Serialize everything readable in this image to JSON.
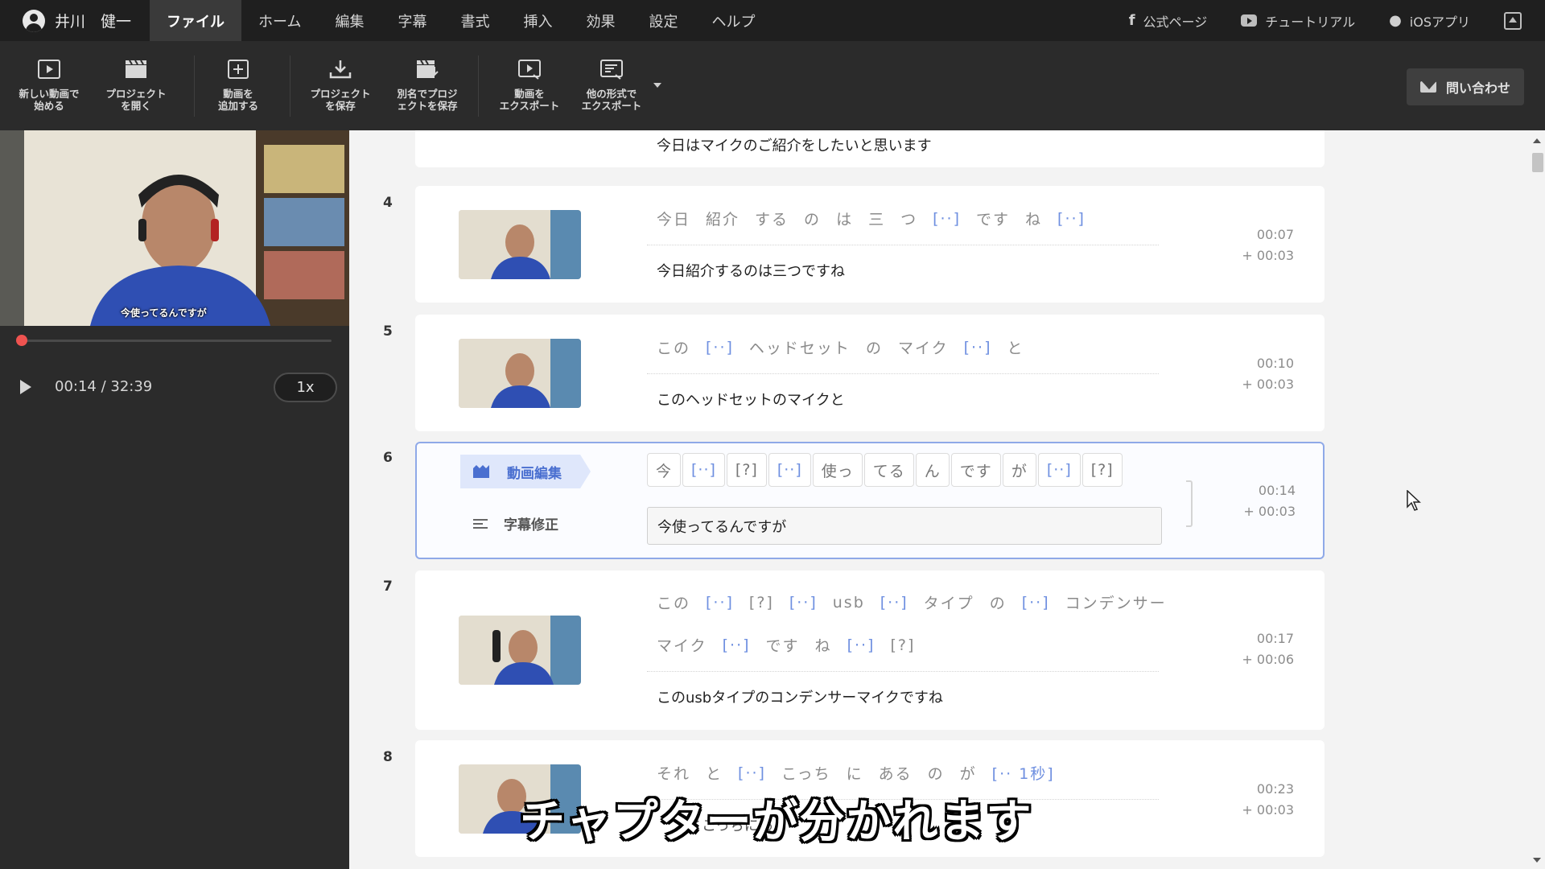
{
  "colors": {
    "accent": "#6e8fe0",
    "selected_border": "#8fa9e8",
    "seek": "#ef5350",
    "menubar": "#1f1f1f",
    "toolbar": "#2b2b2b"
  },
  "user": {
    "name": "井川　健一"
  },
  "menu": {
    "tabs": [
      "ファイル",
      "ホーム",
      "編集",
      "字幕",
      "書式",
      "挿入",
      "効果",
      "設定",
      "ヘルプ"
    ],
    "active": "ファイル"
  },
  "links": {
    "official": "公式ページ",
    "tutorial": "チュートリアル",
    "ios": "iOSアプリ"
  },
  "toolbar": {
    "new_video": [
      "新しい動画で",
      "始める"
    ],
    "open_project": [
      "プロジェクト",
      "を開く"
    ],
    "add_video": [
      "動画を",
      "追加する"
    ],
    "save_project": [
      "プロジェクト",
      "を保存"
    ],
    "save_as": [
      "別名でプロジ",
      "ェクトを保存"
    ],
    "export_video": [
      "動画を",
      "エクスポート"
    ],
    "export_other": [
      "他の形式で",
      "エクスポート"
    ],
    "contact": "問い合わせ"
  },
  "player": {
    "time": "00:14 / 32:39",
    "speed": "1x",
    "video_caption": "今使ってるんですが",
    "progress": 0.007
  },
  "rows": [
    {
      "num": "",
      "text": "今日はマイクのご紹介をしたいと思います"
    },
    {
      "num": "4",
      "tokens": [
        "今日",
        "紹介",
        "する",
        "の",
        "は",
        "三",
        "つ",
        "[··]",
        "です",
        "ね",
        "[··]"
      ],
      "text": "今日紹介するのは三つですね",
      "start": "00:07",
      "dur": "+ 00:03"
    },
    {
      "num": "5",
      "tokens": [
        "この",
        "[··]",
        "ヘッドセット",
        "の",
        "マイク",
        "[··]",
        "と"
      ],
      "text": "このヘッドセットのマイクと",
      "start": "00:10",
      "dur": "+ 00:03"
    },
    {
      "num": "6",
      "tokens": [
        "今",
        "[··]",
        "[?]",
        "[··]",
        "使っ",
        "てる",
        "ん",
        "です",
        "が",
        "[··]",
        "[?]"
      ],
      "text": "今使ってるんですが",
      "start": "00:14",
      "dur": "+ 00:03",
      "video_edit": "動画編集",
      "subtitle_edit": "字幕修正"
    },
    {
      "num": "7",
      "tokens": [
        "この",
        "[··]",
        "[?]",
        "[··]",
        "usb",
        "[··]",
        "タイプ",
        "の",
        "[··]",
        "コンデンサー"
      ],
      "tokens2": [
        "マイク",
        "[··]",
        "です",
        "ね",
        "[··]",
        "[?]"
      ],
      "text": "このusbタイプのコンデンサーマイクですね",
      "start": "00:17",
      "dur": "+ 00:06"
    },
    {
      "num": "8",
      "tokens": [
        "それ",
        "と",
        "[··]",
        "こっち",
        "に",
        "ある",
        "の",
        "が",
        "[·· 1秒]"
      ],
      "text": "とこっちにある",
      "start": "00:23",
      "dur": "+ 00:03"
    }
  ],
  "overlay_caption": "チャプターが分かれます"
}
